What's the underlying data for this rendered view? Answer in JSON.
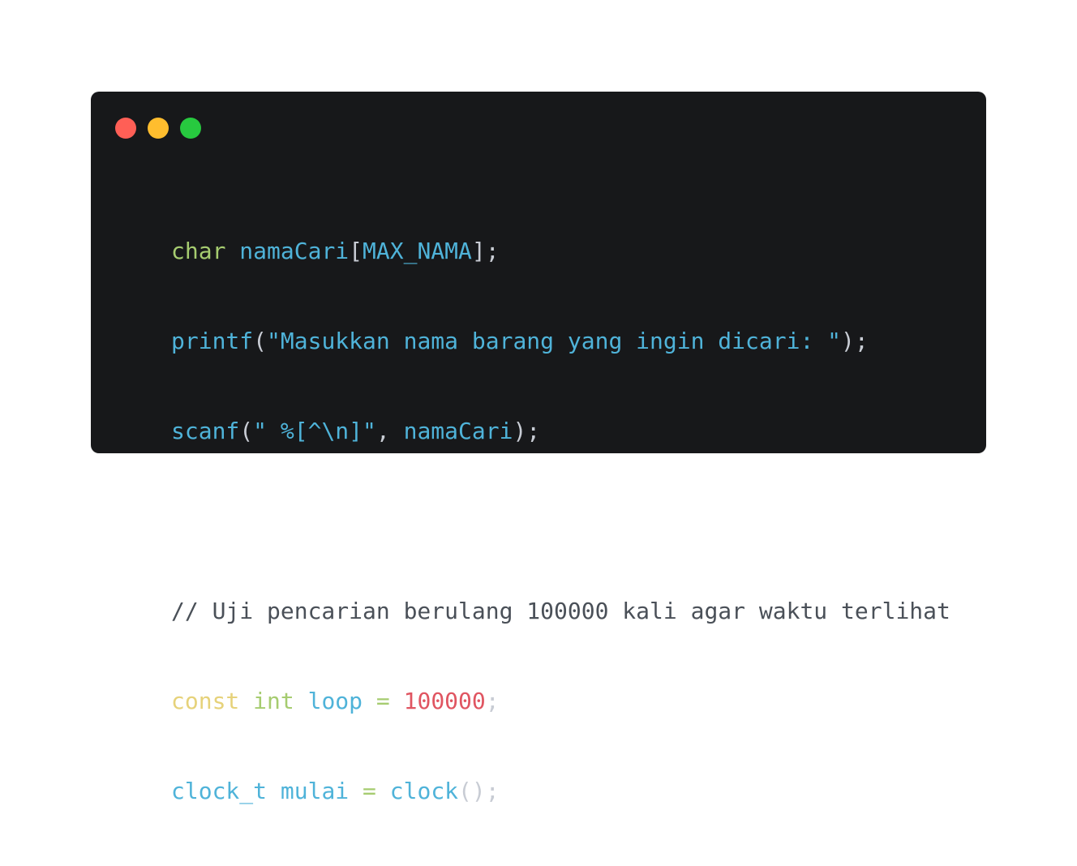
{
  "window": {
    "background": "#17181a",
    "controls": [
      {
        "name": "close",
        "color": "#ff5f56"
      },
      {
        "name": "minimize",
        "color": "#ffbd2e"
      },
      {
        "name": "maximize",
        "color": "#27c93f"
      }
    ]
  },
  "colors": {
    "type": "#a6cc70",
    "identifier": "#4fb3d9",
    "keyword_const": "#e6d27a",
    "number": "#e05561",
    "comment": "#4a5058",
    "punctuation": "#c8ccd4"
  },
  "code": {
    "line1": {
      "type": "char",
      "sp1": " ",
      "ident": "namaCari",
      "lb": "[",
      "macro": "MAX_NAMA",
      "end": "];"
    },
    "line2": {
      "fn": "printf",
      "open": "(",
      "str": "\"Masukkan nama barang yang ingin dicari: \"",
      "end": ");"
    },
    "line3": {
      "fn": "scanf",
      "open": "(",
      "str": "\" %[^\\n]\"",
      "comma": ", ",
      "ident": "namaCari",
      "end": ");"
    },
    "line4": {
      "comment": "// Uji pencarian berulang 100000 kali agar waktu terlihat"
    },
    "line5": {
      "kw": "const",
      "sp1": " ",
      "type": "int",
      "sp2": " ",
      "ident": "loop",
      "op": " = ",
      "num": "100000",
      "end": ";"
    },
    "line6": {
      "type": "clock_t",
      "sp1": " ",
      "ident": "mulai",
      "op": " = ",
      "fn": "clock",
      "end": "();"
    }
  }
}
